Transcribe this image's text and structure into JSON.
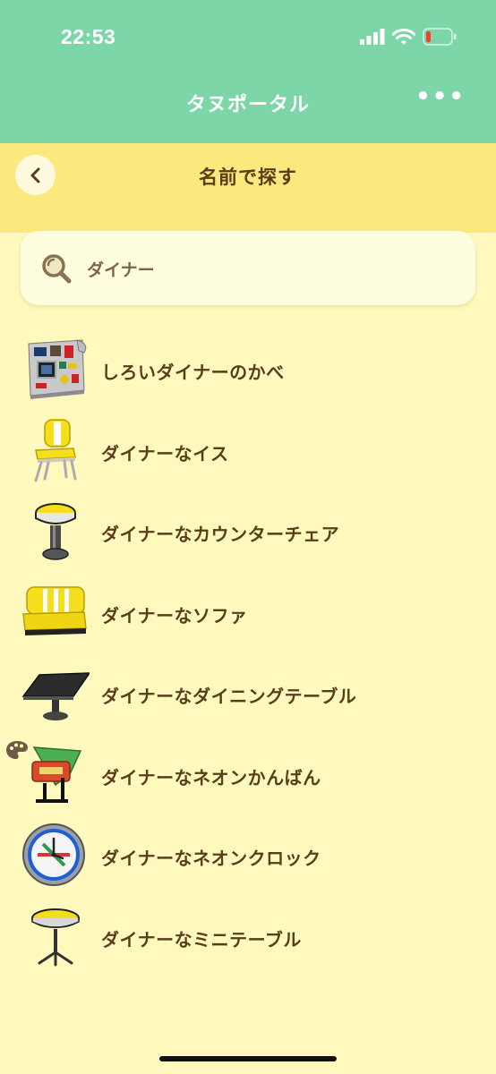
{
  "status": {
    "time": "22:53"
  },
  "header": {
    "title": "タヌポータル",
    "more_label": "•••"
  },
  "subheader": {
    "title": "名前で探す"
  },
  "search": {
    "value": "ダイナー"
  },
  "results": [
    {
      "label": "しろいダイナーのかべ",
      "icon": "white-diner-wall-icon"
    },
    {
      "label": "ダイナーなイス",
      "icon": "diner-chair-icon"
    },
    {
      "label": "ダイナーなカウンターチェア",
      "icon": "diner-counter-chair-icon"
    },
    {
      "label": "ダイナーなソファ",
      "icon": "diner-sofa-icon"
    },
    {
      "label": "ダイナーなダイニングテーブル",
      "icon": "diner-dining-table-icon"
    },
    {
      "label": "ダイナーなネオンかんばん",
      "icon": "diner-neon-sign-icon"
    },
    {
      "label": "ダイナーなネオンクロック",
      "icon": "diner-neon-clock-icon"
    },
    {
      "label": "ダイナーなミニテーブル",
      "icon": "diner-mini-table-icon"
    }
  ],
  "colors": {
    "header": "#7dd6a8",
    "subheader": "#fbe97e",
    "background": "#fff9bd",
    "text": "#5a3d1a"
  }
}
